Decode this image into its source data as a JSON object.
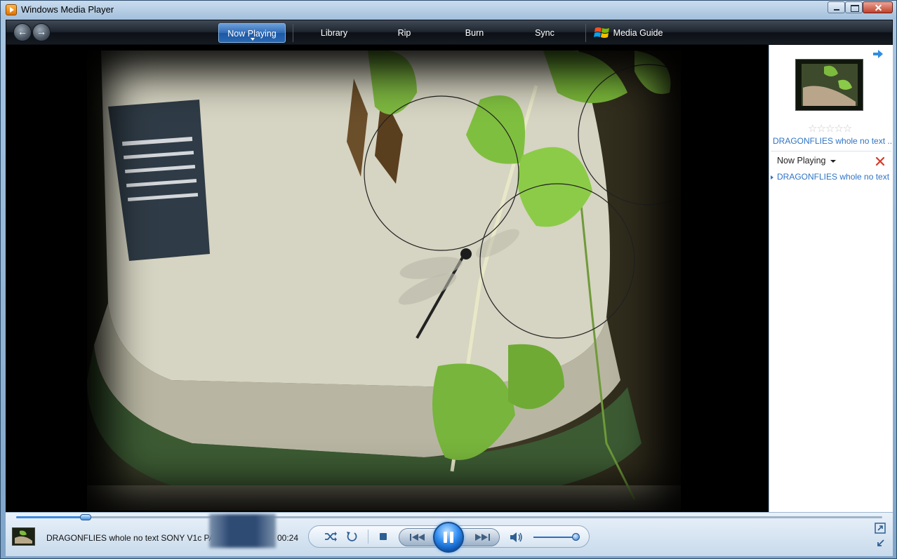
{
  "window": {
    "title": "Windows Media Player"
  },
  "nav": {
    "tabs": {
      "now_playing": "Now Playing",
      "library": "Library",
      "rip": "Rip",
      "burn": "Burn",
      "sync": "Sync",
      "media_guide": "Media Guide"
    },
    "back_icon": "back-arrow-icon",
    "forward_icon": "forward-arrow-icon"
  },
  "pane": {
    "track_title": "DRAGONFLIES whole no text ...",
    "rating_stars": "☆☆☆☆☆",
    "playlist_label": "Now Playing",
    "playlist_items": [
      "DRAGONFLIES whole no text ..."
    ]
  },
  "player": {
    "track_title": "DRAGONFLIES whole no text SONY V1c PART1",
    "elapsed": "00:24",
    "seek_fraction": 0.08,
    "volume_fraction": 0.95
  },
  "colors": {
    "accent": "#2f74c6",
    "nav_bg": "#1e252e",
    "play_button": "#2f8df2"
  }
}
